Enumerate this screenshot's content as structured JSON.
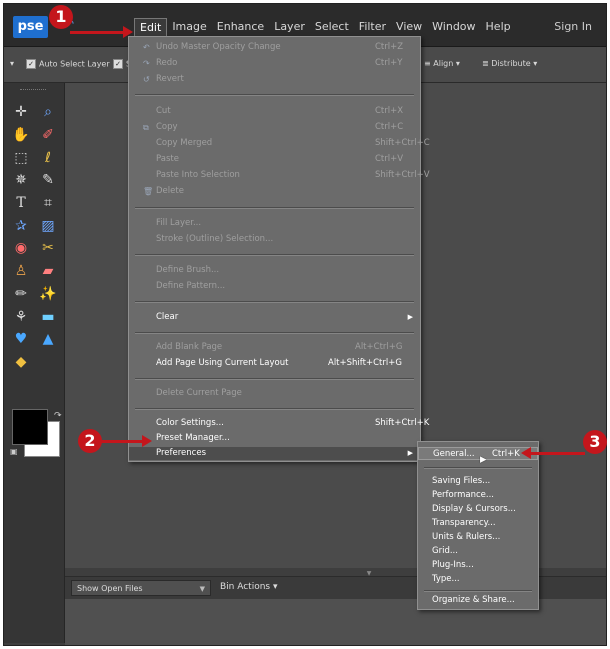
{
  "app": {
    "logo": "pse",
    "menus": [
      "Edit",
      "Image",
      "Enhance",
      "Layer",
      "Select",
      "Filter",
      "View",
      "Window",
      "Help"
    ],
    "active_menu": "Edit",
    "sign_in": "Sign In"
  },
  "options_bar": {
    "auto_select_layer": "Auto Select Layer",
    "show_prefix": "S",
    "align": "Align",
    "distribute": "Distribute"
  },
  "edit_menu": {
    "items": [
      {
        "label": "Undo Master Opacity Change",
        "shortcut": "Ctrl+Z",
        "enabled": false,
        "icon": "undo-icon"
      },
      {
        "label": "Redo",
        "shortcut": "Ctrl+Y",
        "enabled": false,
        "icon": "redo-icon"
      },
      {
        "label": "Revert",
        "shortcut": "",
        "enabled": false,
        "icon": "revert-icon"
      },
      {
        "label": "Cut",
        "shortcut": "Ctrl+X",
        "enabled": false
      },
      {
        "label": "Copy",
        "shortcut": "Ctrl+C",
        "enabled": false,
        "icon": "copy-icon"
      },
      {
        "label": "Copy Merged",
        "shortcut": "Shift+Ctrl+C",
        "enabled": false
      },
      {
        "label": "Paste",
        "shortcut": "Ctrl+V",
        "enabled": false
      },
      {
        "label": "Paste Into Selection",
        "shortcut": "Shift+Ctrl+V",
        "enabled": false
      },
      {
        "label": "Delete",
        "shortcut": "",
        "enabled": false,
        "icon": "delete-icon"
      },
      {
        "label": "Fill Layer...",
        "shortcut": "",
        "enabled": false
      },
      {
        "label": "Stroke (Outline) Selection...",
        "shortcut": "",
        "enabled": false
      },
      {
        "label": "Define Brush...",
        "shortcut": "",
        "enabled": false
      },
      {
        "label": "Define Pattern...",
        "shortcut": "",
        "enabled": false
      },
      {
        "label": "Clear",
        "shortcut": "",
        "enabled": true,
        "submenu": true
      },
      {
        "label": "Add Blank Page",
        "shortcut": "Alt+Ctrl+G",
        "enabled": false
      },
      {
        "label": "Add Page Using Current Layout",
        "shortcut": "Alt+Shift+Ctrl+G",
        "enabled": true
      },
      {
        "label": "Delete Current Page",
        "shortcut": "",
        "enabled": false
      },
      {
        "label": "Color Settings...",
        "shortcut": "Shift+Ctrl+K",
        "enabled": true
      },
      {
        "label": "Preset Manager...",
        "shortcut": "",
        "enabled": true
      },
      {
        "label": "Preferences",
        "shortcut": "",
        "enabled": true,
        "submenu": true,
        "highlighted": true
      }
    ]
  },
  "preferences_menu": {
    "items": [
      {
        "label": "General...",
        "shortcut": "Ctrl+K",
        "highlighted": true
      },
      {
        "label": "Saving Files..."
      },
      {
        "label": "Performance..."
      },
      {
        "label": "Display & Cursors..."
      },
      {
        "label": "Transparency..."
      },
      {
        "label": "Units & Rulers..."
      },
      {
        "label": "Grid..."
      },
      {
        "label": "Plug-Ins..."
      },
      {
        "label": "Type..."
      },
      {
        "label": "Organize & Share..."
      }
    ]
  },
  "bin": {
    "show_open_files": "Show Open Files",
    "bin_actions": "Bin Actions"
  },
  "callouts": [
    "1",
    "2",
    "3"
  ],
  "colors": {
    "callout": "#c4161c",
    "logo": "#1f6fcf",
    "foreground": "#000000",
    "background": "#ffffff"
  }
}
